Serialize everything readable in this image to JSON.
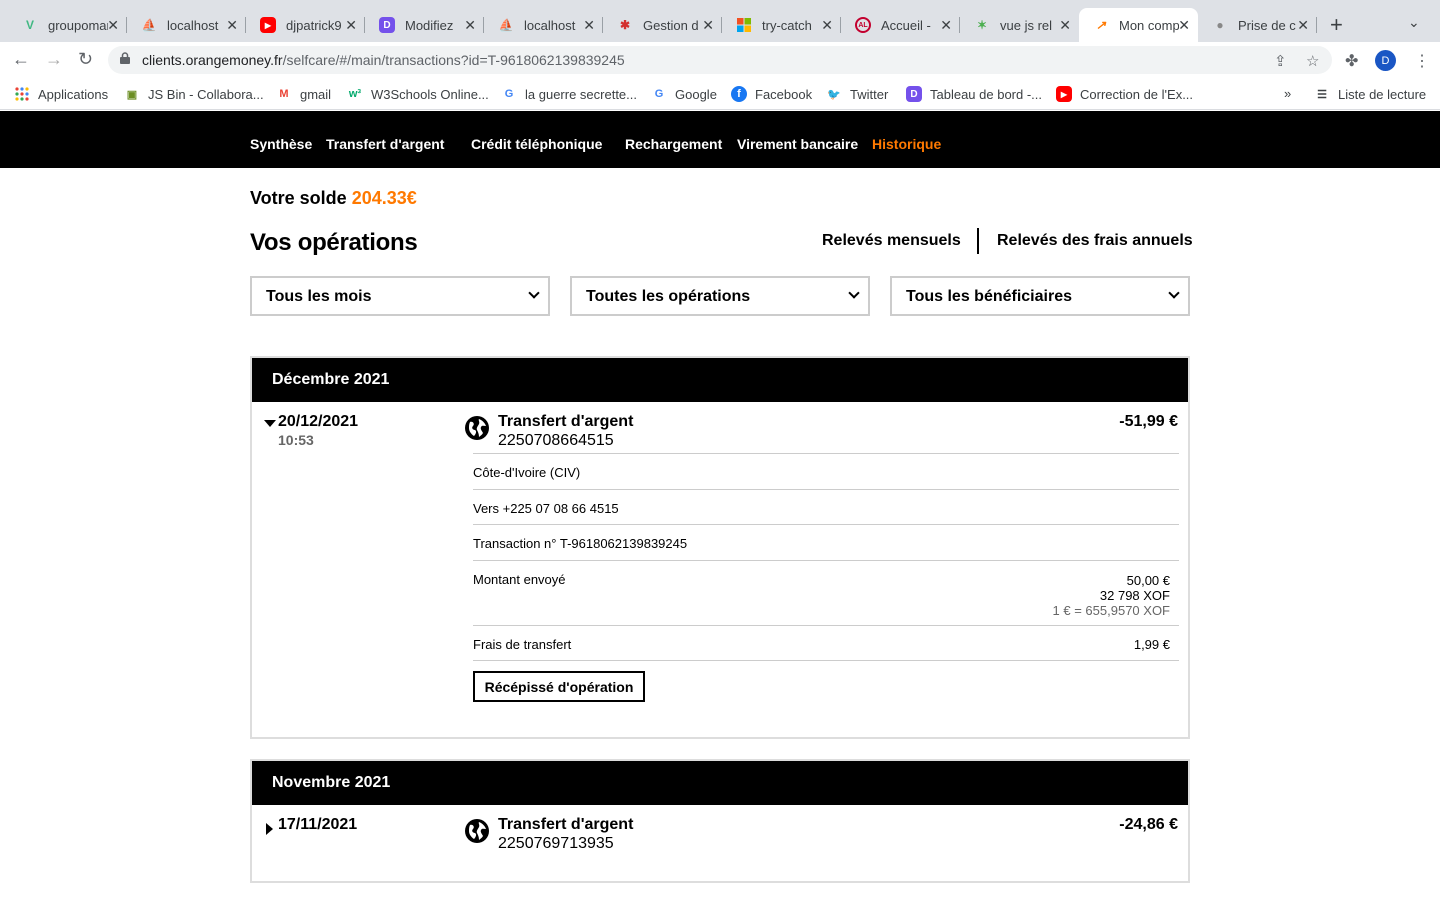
{
  "browser": {
    "tabs": [
      {
        "title": "groupomania",
        "icon": "vue-icon"
      },
      {
        "title": "localhost",
        "icon": "phpmyadmin-icon"
      },
      {
        "title": "djpatrick9",
        "icon": "youtube-icon"
      },
      {
        "title": "Modifiez",
        "icon": "openclassrooms-icon"
      },
      {
        "title": "localhost",
        "icon": "phpmyadmin-icon"
      },
      {
        "title": "Gestion d",
        "icon": "figure-icon"
      },
      {
        "title": "try-catch",
        "icon": "microsoft-icon"
      },
      {
        "title": "Accueil -",
        "icon": "angular-icon"
      },
      {
        "title": "vue js rel",
        "icon": "pinwheel-icon"
      },
      {
        "title": "Mon comp",
        "icon": "orange-money-icon"
      },
      {
        "title": "Prise de c",
        "icon": "apple-icon"
      }
    ],
    "address": {
      "host": "clients.orangemoney.fr",
      "path": "/selfcare/#/main/transactions?id=T-9618062139839245"
    },
    "profile_initial": "D",
    "bookmarks": [
      {
        "label": "Applications",
        "icon": "apps-grid-icon"
      },
      {
        "label": "JS Bin - Collabora...",
        "icon": "jsbin-icon"
      },
      {
        "label": "gmail",
        "icon": "gmail-icon"
      },
      {
        "label": "W3Schools Online...",
        "icon": "w3schools-icon"
      },
      {
        "label": "la guerre secrette...",
        "icon": "google-icon"
      },
      {
        "label": "Google",
        "icon": "google-icon"
      },
      {
        "label": "Facebook",
        "icon": "facebook-icon"
      },
      {
        "label": "Twitter",
        "icon": "twitter-icon"
      },
      {
        "label": "Tableau de bord -...",
        "icon": "openclassrooms-icon"
      },
      {
        "label": "Correction de l'Ex...",
        "icon": "youtube-icon"
      }
    ],
    "more_bookmarks": "»",
    "reading_list": "Liste de lecture"
  },
  "site_nav": [
    {
      "label": "Synthèse",
      "active": false
    },
    {
      "label": "Transfert d'argent",
      "active": false
    },
    {
      "label": "Crédit téléphonique",
      "active": false
    },
    {
      "label": "Rechargement",
      "active": false
    },
    {
      "label": "Virement bancaire",
      "active": false
    },
    {
      "label": "Historique",
      "active": true
    }
  ],
  "balance": {
    "label": "Votre solde",
    "amount": "204.33€"
  },
  "page_title": "Vos opérations",
  "links": {
    "monthly": "Relevés mensuels",
    "annual_fees": "Relevés des frais annuels"
  },
  "filters": {
    "month": "Tous les mois",
    "operations": "Toutes les opérations",
    "beneficiaries": "Tous les bénéficiaires"
  },
  "months": [
    {
      "title": "Décembre 2021",
      "transaction": {
        "date": "20/12/2021",
        "time": "10:53",
        "type": "Transfert d'argent",
        "number": "2250708664515",
        "amount": "-51,99 €",
        "expanded": true,
        "details": {
          "country": "Côte-d'Ivoire (CIV)",
          "recipient": "Vers +225 07 08 66 4515",
          "transaction_id": "Transaction n° T-9618062139839245",
          "sent_label": "Montant envoyé",
          "sent_eur": "50,00 €",
          "sent_xof": "32 798 XOF",
          "rate": "1 € = 655,9570 XOF",
          "fees_label": "Frais de transfert",
          "fees": "1,99 €",
          "receipt_button": "Récépissé d'opération"
        }
      }
    },
    {
      "title": "Novembre 2021",
      "transaction": {
        "date": "17/11/2021",
        "type": "Transfert d'argent",
        "number": "2250769713935",
        "amount": "-24,86 €",
        "expanded": false
      }
    }
  ],
  "colors": {
    "accent": "#ff7900",
    "nav_bg": "#000000"
  }
}
